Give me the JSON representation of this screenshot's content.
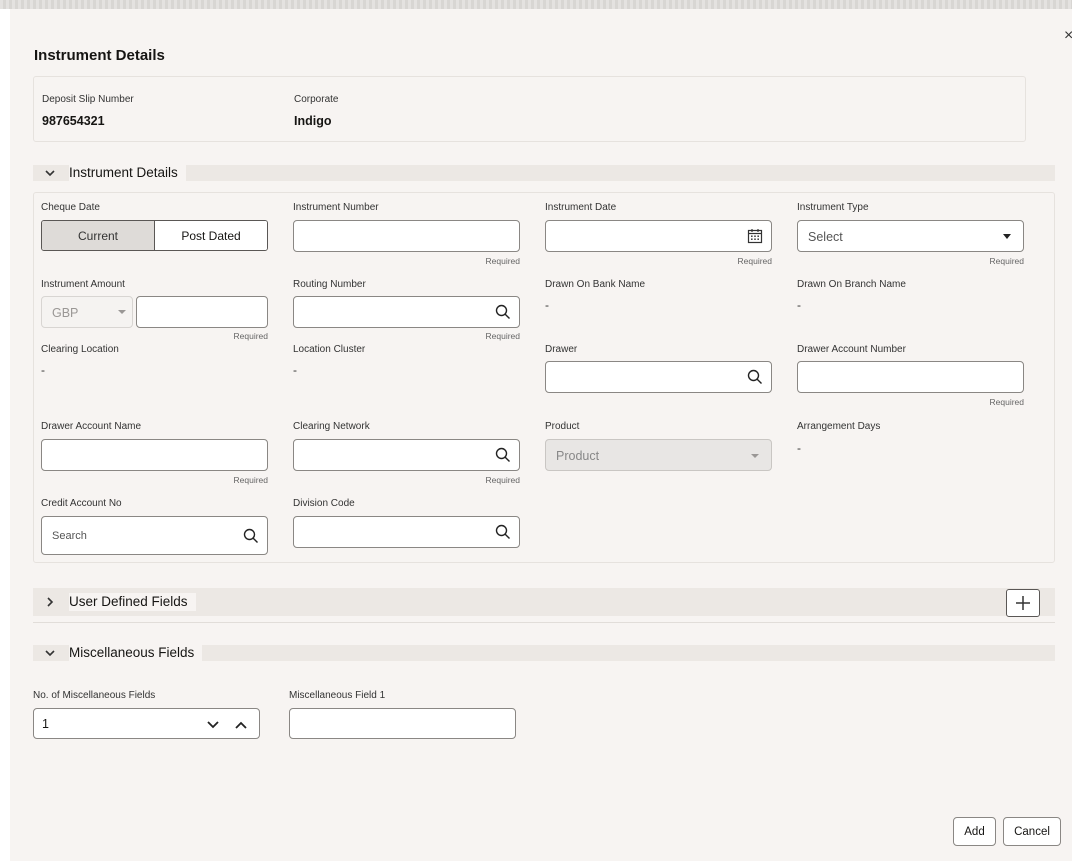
{
  "modal": {
    "title": "Instrument Details",
    "close_glyph": "×"
  },
  "info": {
    "deposit_slip_label": "Deposit Slip Number",
    "deposit_slip_value": "987654321",
    "corporate_label": "Corporate",
    "corporate_value": "Indigo"
  },
  "sections": {
    "instrument_details": "Instrument Details",
    "user_defined_fields": "User Defined Fields",
    "miscellaneous_fields": "Miscellaneous Fields"
  },
  "fields": {
    "cheque_date_label": "Cheque Date",
    "cheque_date_options": [
      "Current",
      "Post Dated"
    ],
    "cheque_date_selected": "Current",
    "instrument_number_label": "Instrument Number",
    "instrument_date_label": "Instrument Date",
    "instrument_type_label": "Instrument Type",
    "instrument_type_placeholder": "Select",
    "instrument_amount_label": "Instrument Amount",
    "currency_value": "GBP",
    "routing_number_label": "Routing Number",
    "drawn_on_bank_label": "Drawn On Bank Name",
    "drawn_on_bank_value": "-",
    "drawn_on_branch_label": "Drawn On Branch Name",
    "drawn_on_branch_value": "-",
    "clearing_location_label": "Clearing Location",
    "clearing_location_value": "-",
    "location_cluster_label": "Location Cluster",
    "location_cluster_value": "-",
    "drawer_label": "Drawer",
    "drawer_account_number_label": "Drawer Account Number",
    "drawer_account_name_label": "Drawer Account Name",
    "clearing_network_label": "Clearing Network",
    "product_label": "Product",
    "product_placeholder": "Product",
    "arrangement_days_label": "Arrangement Days",
    "arrangement_days_value": "-",
    "credit_account_label": "Credit Account No",
    "credit_account_placeholder": "Search",
    "division_code_label": "Division Code",
    "required_text": "Required"
  },
  "misc": {
    "count_label": "No. of Miscellaneous Fields",
    "count_value": "1",
    "field1_label": "Miscellaneous Field 1"
  },
  "footer": {
    "add_label": "Add",
    "cancel_label": "Cancel"
  },
  "icons": {
    "search": "search-icon",
    "calendar": "calendar-icon",
    "close": "close-icon",
    "plus": "plus-icon"
  }
}
